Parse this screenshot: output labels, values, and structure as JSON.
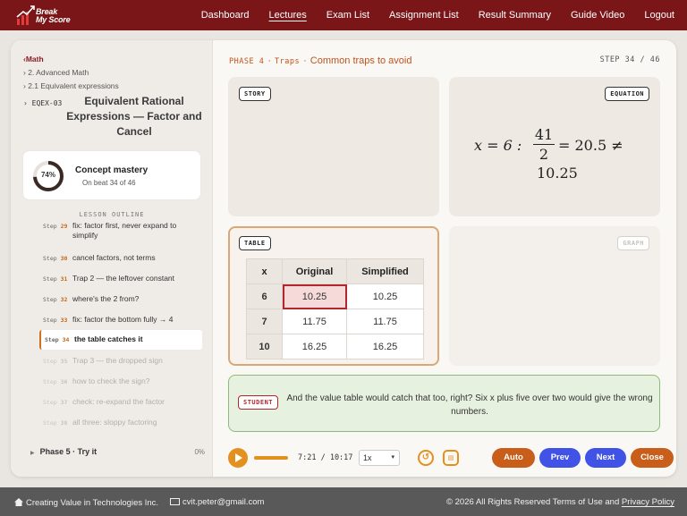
{
  "nav": {
    "logo_line1": "Break",
    "logo_line2": "My Score",
    "items": [
      {
        "label": "Dashboard"
      },
      {
        "label": "Lectures",
        "active": true
      },
      {
        "label": "Exam List"
      },
      {
        "label": "Assignment List"
      },
      {
        "label": "Result Summary"
      },
      {
        "label": "Guide Video"
      },
      {
        "label": "Logout"
      }
    ]
  },
  "sidebar": {
    "crumbs": [
      "‹Math",
      "› 2. Advanced Math",
      "› 2.1 Equivalent expressions"
    ],
    "exercise_id": "› EQEX-03",
    "exercise_title": "Equivalent Rational Expressions — Factor and Cancel",
    "mastery": {
      "value_label": "74%",
      "value": 74,
      "title": "Concept mastery",
      "subtitle": "On beat 34 of 46"
    },
    "outline_heading": "LESSON OUTLINE",
    "steps": [
      {
        "prefix": "Step",
        "num": "29",
        "label": "fix: factor first, never expand to simplify",
        "state": "done"
      },
      {
        "prefix": "Step",
        "num": "30",
        "label": "cancel factors, not terms",
        "state": "done"
      },
      {
        "prefix": "Step",
        "num": "31",
        "label": "Trap 2 — the leftover constant",
        "state": "done"
      },
      {
        "prefix": "Step",
        "num": "32",
        "label": "where's the 2 from?",
        "state": "done"
      },
      {
        "prefix": "Step",
        "num": "33",
        "label": "fix: factor the bottom fully → 4",
        "state": "done"
      },
      {
        "prefix": "Step",
        "num": "34",
        "label": "the table catches it",
        "state": "active"
      },
      {
        "prefix": "Step",
        "num": "35",
        "label": "Trap 3 — the dropped sign",
        "state": "upcoming"
      },
      {
        "prefix": "Step",
        "num": "36",
        "label": "how to check the sign?",
        "state": "upcoming"
      },
      {
        "prefix": "Step",
        "num": "37",
        "label": "check: re-expand the factor",
        "state": "upcoming"
      },
      {
        "prefix": "Step",
        "num": "38",
        "label": "all three: sloppy factoring",
        "state": "upcoming"
      }
    ],
    "next_phase": {
      "label": "Phase 5 · Try it",
      "pct": "0%"
    }
  },
  "main": {
    "phase_code": "PHASE 4",
    "phase_name": "Traps",
    "phase_desc": "Common traps to avoid",
    "step_counter": "STEP 34 / 46",
    "tags": {
      "story": "STORY",
      "equation": "EQUATION",
      "table": "TABLE",
      "graph": "GRAPH",
      "student": "STUDENT"
    },
    "equation": {
      "lhs": "x = 6 :",
      "frac_num": "41",
      "frac_den": "2",
      "rhs": "= 20.5 ≠",
      "last": "10.25"
    },
    "table": {
      "headers": [
        "x",
        "Original",
        "Simplified"
      ],
      "rows": [
        {
          "x": "6",
          "original": "10.25",
          "simplified": "10.25",
          "highlight": true
        },
        {
          "x": "7",
          "original": "11.75",
          "simplified": "11.75"
        },
        {
          "x": "10",
          "original": "16.25",
          "simplified": "16.25"
        }
      ]
    },
    "student_text": "And the value table would catch that too, right? Six x plus five over two would give the wrong numbers."
  },
  "controls": {
    "progress": 1.0,
    "time": "7:21 / 10:17",
    "speed": "1x",
    "auto": "Auto",
    "prev": "Prev",
    "next": "Next",
    "close": "Close"
  },
  "footer": {
    "company": "Creating Value in Technologies Inc.",
    "email": "cvit.peter@gmail.com",
    "copyright": "© 2026 All Rights Reserved Terms of Use and",
    "privacy": "Privacy Policy"
  },
  "colors": {
    "brand": "#7a1518",
    "accent": "#e4901e",
    "primary_button": "#4053e6",
    "student_bg": "#e7f1e0",
    "highlight_cell": "#b3262b"
  }
}
